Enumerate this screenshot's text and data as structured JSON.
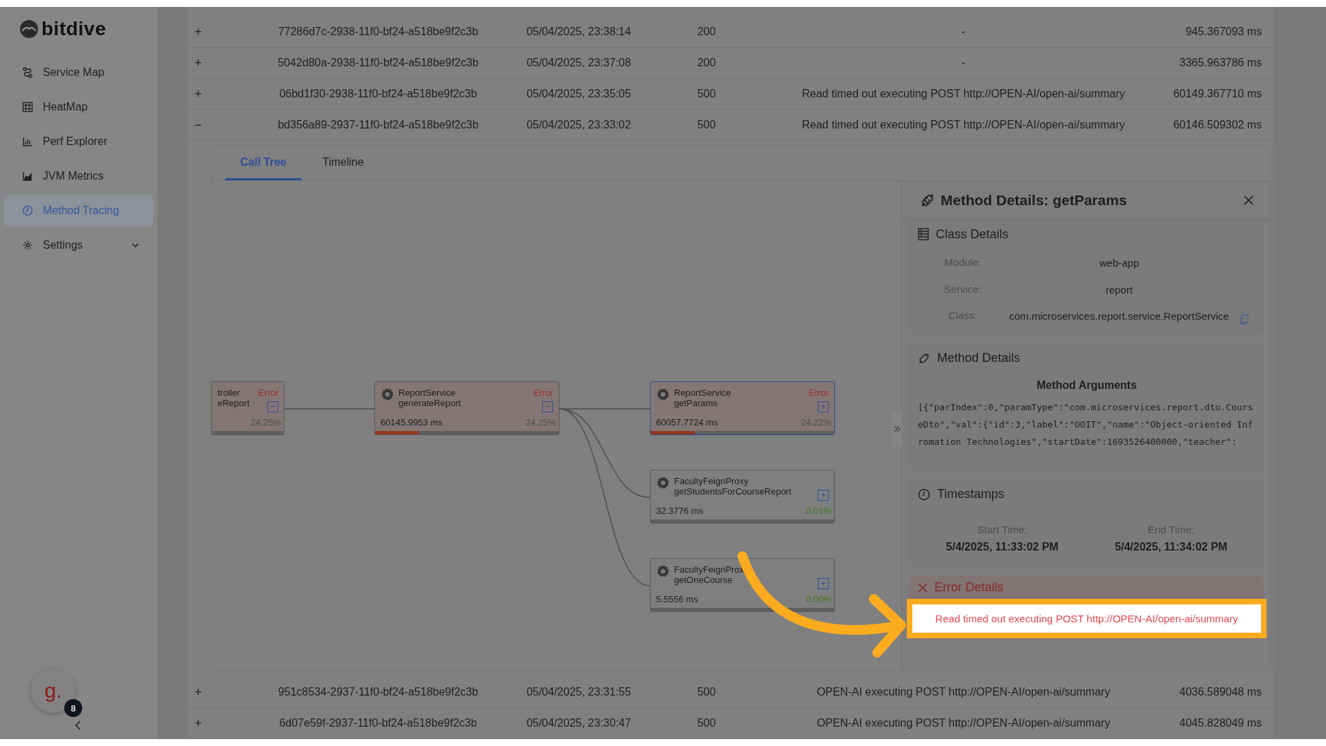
{
  "sidebar": {
    "logo": "bitdive",
    "items": [
      {
        "label": "Service Map",
        "selected": false,
        "kind": "link"
      },
      {
        "label": "HeatMap",
        "selected": false,
        "kind": "link"
      },
      {
        "label": "Perf Explorer",
        "selected": false,
        "kind": "link"
      },
      {
        "label": "JVM Metrics",
        "selected": false,
        "kind": "link"
      },
      {
        "label": "Method Tracing",
        "selected": true,
        "kind": "link"
      },
      {
        "label": "Settings",
        "selected": false,
        "kind": "group"
      }
    ]
  },
  "user": {
    "initial": "g.",
    "badge": "8"
  },
  "rows_top": [
    {
      "expander": "+",
      "id": "77286d7c-2938-11f0-bf24-a518be9f2c3b",
      "time": "05/04/2025, 23:38:14",
      "status": "200",
      "message": "-",
      "duration": "945.367093 ms"
    },
    {
      "expander": "+",
      "id": "5042d80a-2938-11f0-bf24-a518be9f2c3b",
      "time": "05/04/2025, 23:37:08",
      "status": "200",
      "message": "-",
      "duration": "3365.963786 ms"
    },
    {
      "expander": "+",
      "id": "06bd1f30-2938-11f0-bf24-a518be9f2c3b",
      "time": "05/04/2025, 23:35:05",
      "status": "500",
      "message": "Read timed out executing POST http://OPEN-AI/open-ai/summary",
      "duration": "60149.367710 ms"
    },
    {
      "expander": "−",
      "id": "bd356a89-2937-11f0-bf24-a518be9f2c3b",
      "time": "05/04/2025, 23:33:02",
      "status": "500",
      "message": "Read timed out executing POST http://OPEN-AI/open-ai/summary",
      "duration": "60146.509302 ms"
    }
  ],
  "tabs": [
    {
      "label": "Call Tree",
      "selected": true
    },
    {
      "label": "Timeline",
      "selected": false
    }
  ],
  "call_tree": {
    "class": "troller",
    "method": "eReport",
    "badge": "Error",
    "share": "24.25%",
    "error": true,
    "selected": false,
    "toggle": "−",
    "children": [
      {
        "class": "ReportService",
        "method": "generateReport",
        "badge": "Error",
        "duration": "60145.9953  ms",
        "share": "24.25%",
        "error": true,
        "selected": false,
        "toggle": "−",
        "level": 0.24,
        "children": [
          {
            "class": "ReportService",
            "method": "getParams",
            "badge": "Error",
            "duration": "60057.7724  ms",
            "share": "24.22%",
            "error": true,
            "selected": true,
            "toggle": "+",
            "level": 0.24
          },
          {
            "class": "FacultyFeignProxy",
            "method": "getStudentsForCourseReport",
            "duration": "32.3776  ms",
            "share": "0.01%",
            "error": false,
            "selected": false,
            "toggle": "+"
          },
          {
            "class": "FacultyFeignProx",
            "method": "getOneCourse",
            "duration": "5.5556  ms",
            "share": "0.00%",
            "error": false,
            "selected": false,
            "toggle": "+"
          }
        ]
      }
    ]
  },
  "details": {
    "title": "Method Details: getParams",
    "class_heading": "Class Details",
    "fields": [
      {
        "label": "Module:",
        "value": "web-app"
      },
      {
        "label": "Service:",
        "value": "report"
      },
      {
        "label": "Class:",
        "value": "com.microservices.report.service.ReportService",
        "copyable": true
      }
    ],
    "method_heading": "Method Details",
    "arguments_heading": "Method Arguments",
    "arguments": "[{\"parIndex\":0,\"paramType\":\"com.microservices.report.dto.CourseDto\",\"val\":{\"id\":3,\"label\":\"OOIT\",\"name\":\"Object-oriented Infromation Technologies\",\"startDate\":1693526400000,\"teacher\":",
    "timestamps_heading": "Timestamps",
    "start_label": "Start Time:",
    "start": "5/4/2025, 11:33:02 PM",
    "end_label": "End Time:",
    "end": "5/4/2025, 11:34:02 PM",
    "error_heading": "Error Details",
    "error_message": "Read timed out executing POST http://OPEN-AI/open-ai/summary"
  },
  "rows_bottom": [
    {
      "expander": "+",
      "id": "951c8534-2937-11f0-bf24-a518be9f2c3b",
      "time": "05/04/2025, 23:31:55",
      "status": "500",
      "message": "OPEN-AI executing POST http://OPEN-AI/open-ai/summary",
      "duration": "4036.589048 ms"
    },
    {
      "expander": "+",
      "id": "6d07e59f-2937-11f0-bf24-a518be9f2c3b",
      "time": "05/04/2025, 23:30:47",
      "status": "500",
      "message": "OPEN-AI executing POST http://OPEN-AI/open-ai/summary",
      "duration": "4045.828049 ms"
    }
  ]
}
